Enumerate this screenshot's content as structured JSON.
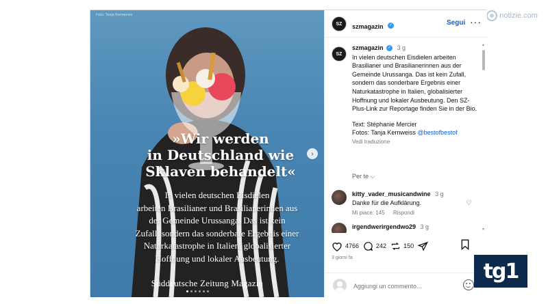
{
  "watermark": {
    "prefix": "7",
    "text": "notizie.com"
  },
  "post": {
    "image": {
      "credit": "Foto: Tanja Kernweiss",
      "headline_lines": [
        "»Wir werden",
        "in Deutschland wie",
        "Sklaven behandelt«"
      ],
      "subtext_lines": [
        "In vielen deutschen Eisdielen",
        "arbeiten Brasilianer und Brasilianerinnen aus",
        "der Gemeinde Urussanga. Das ist kein",
        "Zufall, sondern das sonderbare Ergebnis einer",
        "Naturkatastrophe in Italien, globalisierter",
        "Hoffnung und lokaler Ausbeutung."
      ],
      "brand": "Süddeutsche Zeitung Magazin",
      "next_arrow": "›"
    },
    "header": {
      "avatar_text": "SZ",
      "username": "szmagazin",
      "follow_label": "Segui",
      "more_label": "···"
    },
    "caption": {
      "avatar_text": "SZ",
      "username": "szmagazin",
      "time": "3 g",
      "text": "In vielen deutschen Eisdielen arbeiten Brasilianer und Brasilianerinnen aus der Gemeinde Urussanga. Das ist kein Zufall, sondern das sonderbare Ergebnis einer Naturkatastrophe in Italien, globalisierter Hoffnung und lokaler Ausbeutung. Den SZ-Plus-Link zur Reportage finden Sie in der Bio.",
      "credit_text": "Text: Stéphanie Mercier",
      "credit_photo": "Fotos: Tanja Kernweiss",
      "credit_mention": "@bestofbestof",
      "translate": "Vedi traduzione"
    },
    "per_te": "Per te",
    "comments": [
      {
        "username": "kitty_vader_musicandwine",
        "time": "3 g",
        "text": "Danke für die Aufklärung.",
        "likes": "Mi piace: 145",
        "reply": "Rispondi"
      },
      {
        "username": "irgendwerirgendwo29",
        "time": "3 g"
      }
    ],
    "actions": {
      "likes": "4766",
      "comments": "242",
      "reposts": "150"
    },
    "timestamp": "3 giorni fa",
    "add_comment_placeholder": "Aggiungi un commento..."
  },
  "broadcast_logo": "tg1",
  "colors": {
    "accent": "#0a5ed7",
    "verified": "#3897f0",
    "photo_bg": "#4a86b3",
    "tg1_bg": "#0c2a4d"
  }
}
